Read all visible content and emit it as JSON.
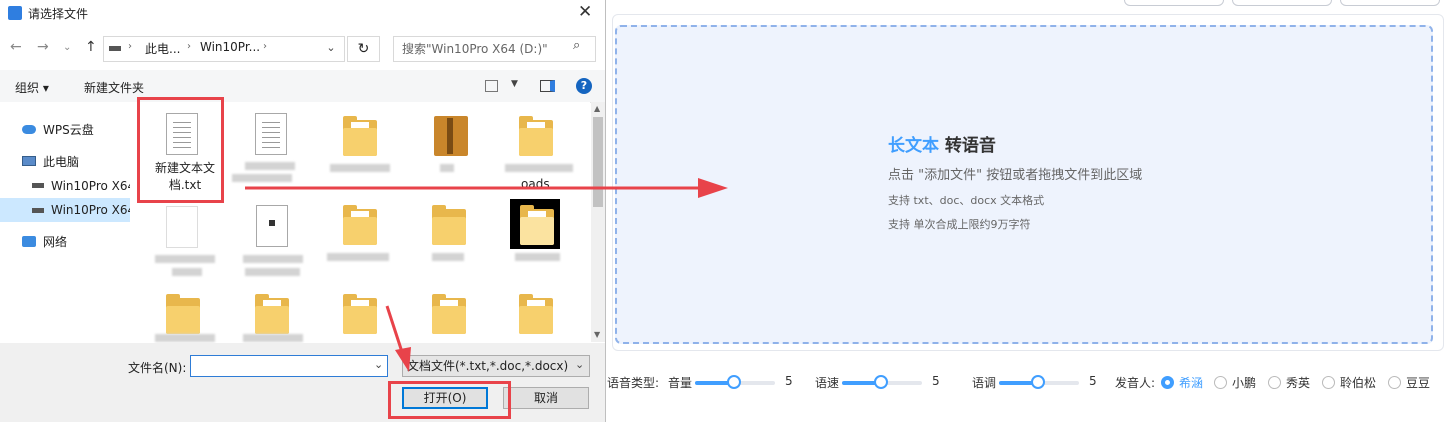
{
  "dialog": {
    "title": "请选择文件",
    "close_glyph": "✕",
    "address_path": [
      "此电...",
      "Win10Pr..."
    ],
    "search_placeholder": "搜索\"Win10Pro X64 (D:)\"",
    "organize_label": "组织 ▾",
    "new_folder_label": "新建文件夹",
    "nav_items": [
      "WPS云盘",
      "此电脑",
      "Win10Pro X64",
      "Win10Pro X64",
      "网络"
    ],
    "selected_file_name": "新建文本文档.txt",
    "partial_label": "oads",
    "file_name_label": "文件名(N):",
    "file_name_value": "",
    "file_type_value": "文档文件(*.txt,*.doc,*.docx)",
    "open_button": "打开(O)",
    "cancel_button": "取消"
  },
  "app": {
    "drop_title_highlight": "长文本",
    "drop_title_rest": " 转语音",
    "drop_hint": "点击 \"添加文件\" 按钮或者拖拽文件到此区域",
    "drop_formats": "支持 txt、doc、docx 文本格式",
    "drop_limit": "支持 单次合成上限约9万字符",
    "voice_type_label": "语音类型:",
    "volume_label": "音量",
    "volume_value": "5",
    "speed_label": "语速",
    "speed_value": "5",
    "pitch_label": "语调",
    "pitch_value": "5",
    "speaker_label": "发音人:",
    "speakers": [
      "希涵",
      "小鹏",
      "秀英",
      "聆伯松",
      "豆豆"
    ],
    "selected_speaker": "希涵",
    "accent_color": "#409eff",
    "annotation_color": "#e8434a"
  }
}
